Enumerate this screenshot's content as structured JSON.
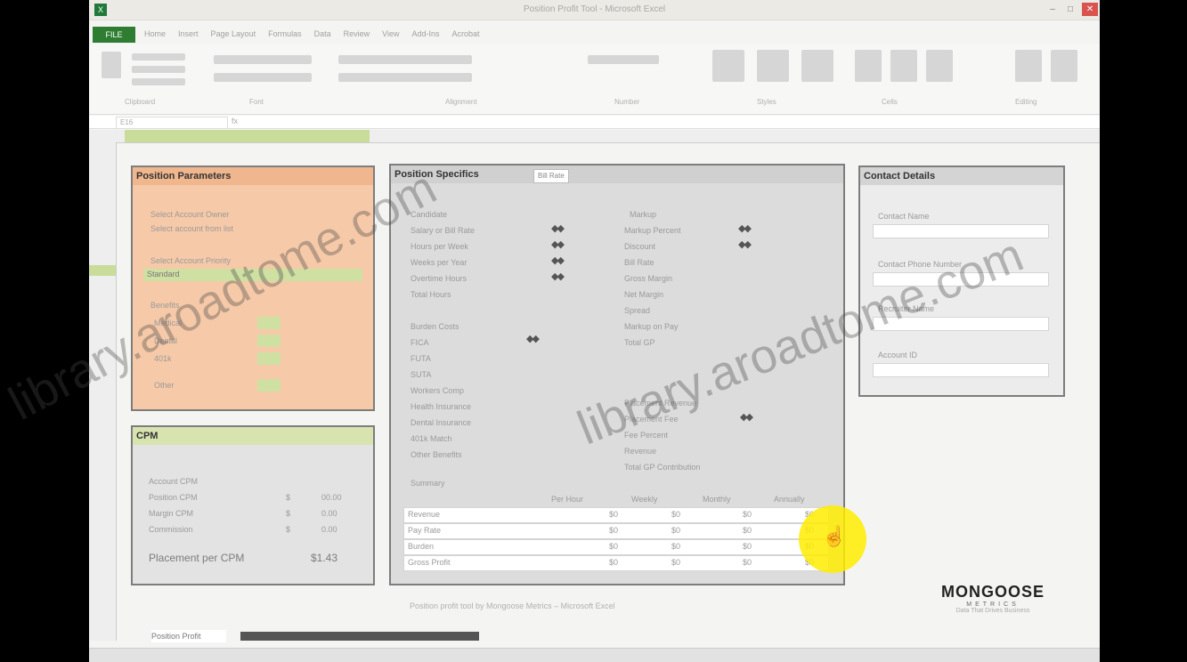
{
  "window": {
    "title": "Position Profit Tool - Microsoft Excel",
    "min": "–",
    "max": "□",
    "close": "✕",
    "app_icon": "X"
  },
  "ribbon": {
    "file_tab": "FILE",
    "tabs": [
      "Home",
      "Insert",
      "Page Layout",
      "Formulas",
      "Data",
      "Review",
      "View",
      "Add-Ins",
      "Acrobat"
    ],
    "groups": [
      "Clipboard",
      "Font",
      "Alignment",
      "Number",
      "Styles",
      "Cells",
      "Editing"
    ]
  },
  "formula_bar": {
    "name_box": "E16",
    "fx": "fx"
  },
  "panels": {
    "position_parameters": {
      "title": "Position Parameters",
      "field1_label": "Select Account Owner",
      "field1_value": "Select account from list",
      "field2_label": "Select Account Priority",
      "field2_value": "Standard",
      "section3_label": "Benefits",
      "rows": [
        "Medical",
        "Dental",
        "401k",
        "Other"
      ]
    },
    "cpm": {
      "title": "CPM",
      "subtitle": "Account CPM",
      "rows": [
        [
          "Position CPM",
          "$",
          "00.00"
        ],
        [
          "Margin CPM",
          "$",
          "0.00"
        ],
        [
          "Commission",
          "$",
          "0.00"
        ]
      ],
      "total_label": "Placement per CPM",
      "total_value": "$1.43"
    },
    "position_specifics": {
      "title": "Position Specifics",
      "subtab": "Bill Rate",
      "left_section1": "Candidate",
      "left_rows1": [
        "Salary or Bill Rate",
        "Hours per Week",
        "Weeks per Year",
        "Overtime Hours",
        "Total Hours"
      ],
      "left_section2": "Burden Costs",
      "left_rows2": [
        "FICA",
        "FUTA",
        "SUTA",
        "Workers Comp",
        "Health Insurance",
        "Dental Insurance",
        "401k Match",
        "Other Benefits"
      ],
      "right_section1": "Markup",
      "right_rows1": [
        "Markup Percent",
        "Discount",
        "Bill Rate",
        "Gross Margin",
        "Net Margin",
        "Spread",
        "Markup on Pay",
        "Total GP"
      ],
      "right_section2": "Placement Revenue",
      "right_rows2": [
        "Placement Fee",
        "Fee Percent",
        "Revenue",
        "Total GP Contribution"
      ],
      "table_title": "Summary",
      "table_headers": [
        "",
        "Per Hour",
        "Weekly",
        "Monthly",
        "Annually"
      ],
      "table_rows": [
        [
          "Revenue",
          "$0",
          "$0",
          "$0",
          "$0"
        ],
        [
          "Pay Rate",
          "$0",
          "$0",
          "$0",
          "$0"
        ],
        [
          "Burden",
          "$0",
          "$0",
          "$0",
          "$0"
        ],
        [
          "Gross Profit",
          "$0",
          "$0",
          "$0",
          "$0"
        ]
      ]
    },
    "contact_details": {
      "title": "Contact Details",
      "fields": [
        "Contact Name",
        "Contact Phone Number",
        "Recruiter Name",
        "Account ID"
      ]
    }
  },
  "footer_note": "Position profit tool by Mongoose Metrics – Microsoft Excel",
  "sheet_tab": "Position Profit",
  "logo": {
    "name": "MONGOOSE",
    "sub": "METRICS",
    "tag": "Data That Drives Business"
  },
  "watermark": {
    "left": "library.aroadtome.com",
    "right": "library.aroadtome.com"
  }
}
